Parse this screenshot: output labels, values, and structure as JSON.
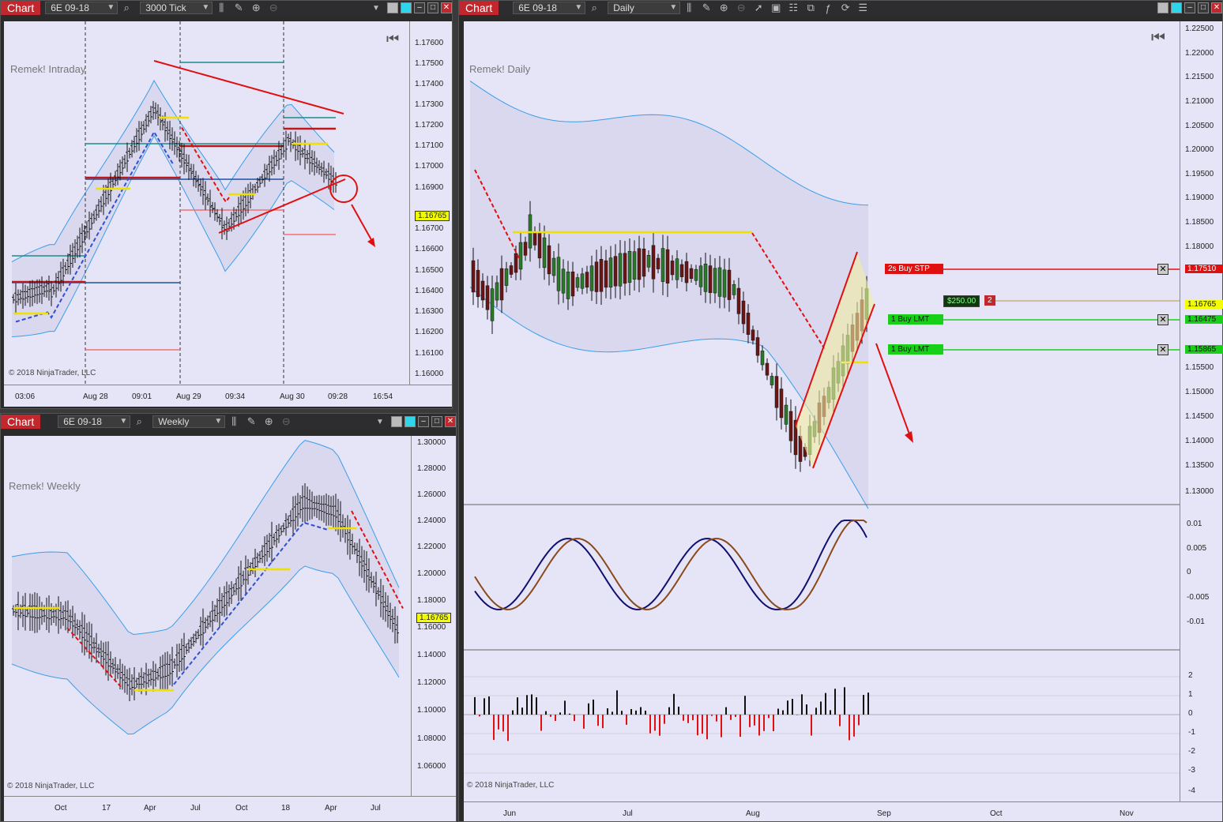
{
  "windows": {
    "intraday": {
      "chart_label": "Chart",
      "instrument": "6E 09-18",
      "period": "3000 Tick",
      "watermark": "Remek! Intraday",
      "copyright": "© 2018 NinjaTrader, LLC",
      "price_labels": [
        "1.17600",
        "1.17500",
        "1.17400",
        "1.17300",
        "1.17200",
        "1.17100",
        "1.17000",
        "1.16900",
        "1.16700",
        "1.16600",
        "1.16500",
        "1.16400",
        "1.16300",
        "1.16200",
        "1.16100",
        "1.16000"
      ],
      "last_price": "1.16765",
      "time_labels": [
        "03:06",
        "Aug 28",
        "09:01",
        "Aug 29",
        "09:34",
        "Aug 30",
        "09:28",
        "16:54"
      ]
    },
    "weekly": {
      "chart_label": "Chart",
      "instrument": "6E 09-18",
      "period": "Weekly",
      "watermark": "Remek! Weekly",
      "copyright": "© 2018 NinjaTrader, LLC",
      "price_labels": [
        "1.30000",
        "1.28000",
        "1.26000",
        "1.24000",
        "1.22000",
        "1.20000",
        "1.18000",
        "1.16000",
        "1.14000",
        "1.12000",
        "1.10000",
        "1.08000",
        "1.06000"
      ],
      "last_price": "1.16765",
      "time_labels": [
        "Oct",
        "17",
        "Apr",
        "Jul",
        "Oct",
        "18",
        "Apr",
        "Jul"
      ]
    },
    "daily": {
      "chart_label": "Chart",
      "instrument": "6E 09-18",
      "period": "Daily",
      "watermark": "Remek! Daily",
      "copyright": "© 2018 NinjaTrader, LLC",
      "price_labels": [
        "1.22500",
        "1.22000",
        "1.21500",
        "1.21000",
        "1.20500",
        "1.20000",
        "1.19500",
        "1.19000",
        "1.18500",
        "1.18000",
        "1.15500",
        "1.15000",
        "1.14500",
        "1.14000",
        "1.13500",
        "1.13000"
      ],
      "osc_labels": [
        "0.01",
        "0.005",
        "0",
        "-0.005",
        "-0.01"
      ],
      "hist_labels": [
        "2",
        "1",
        "0",
        "-1",
        "-2",
        "-3",
        "-4"
      ],
      "time_labels": [
        "Jun",
        "Jul",
        "Aug",
        "Sep",
        "Oct",
        "Nov"
      ],
      "orders": [
        {
          "label": "2s  Buy STP",
          "price": "1.17510",
          "color": "#e01010"
        },
        {
          "label": "1  Buy LMT",
          "price": "1.16475",
          "color": "#18d018"
        },
        {
          "label": "1  Buy LMT",
          "price": "1.15865",
          "color": "#18d018"
        }
      ],
      "position_pnl": "$250.00",
      "position_qty": "2",
      "last_price": "1.16765"
    }
  },
  "colors": {
    "bg": "#e6e4f7",
    "accent_red": "#e01010",
    "green": "#18d018",
    "band": "#3a9ee8"
  }
}
